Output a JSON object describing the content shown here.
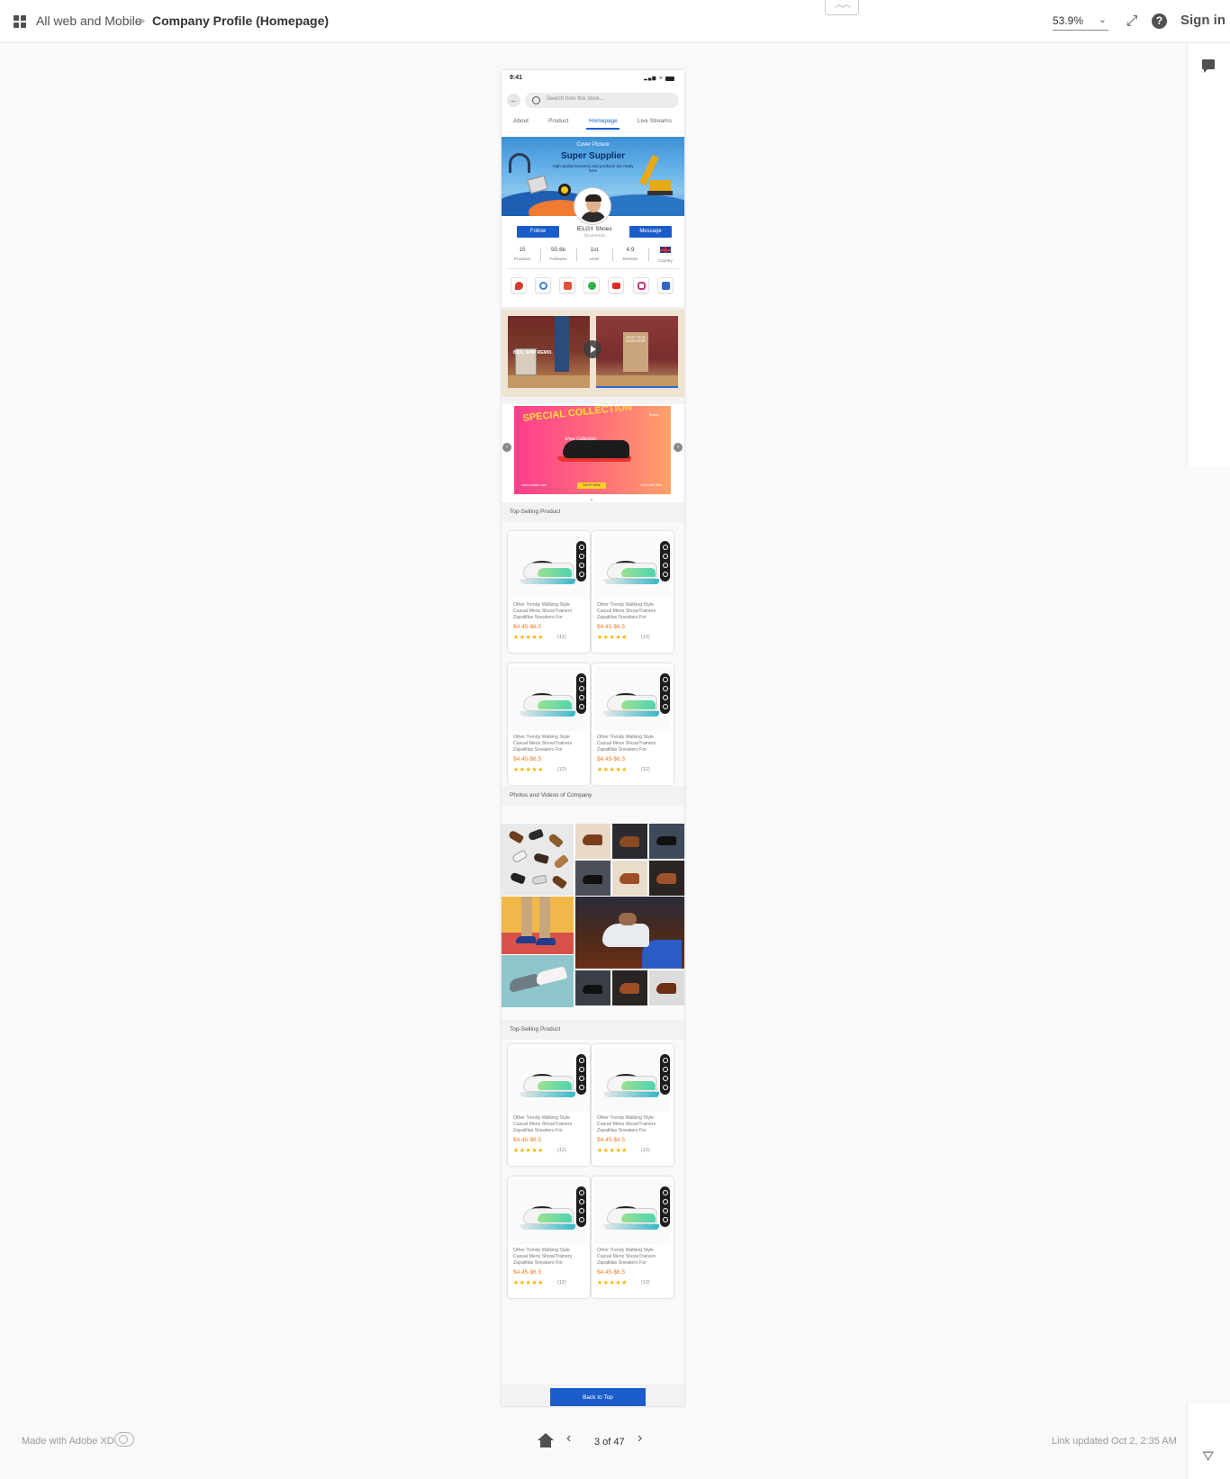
{
  "topbar": {
    "breadcrumb_root": "All web and Mobile",
    "breadcrumb_separator": ">",
    "breadcrumb_current": "Company Profile (Homepage)",
    "zoom": "53.9%",
    "sign_in": "Sign in"
  },
  "footer": {
    "made_with": "Made with Adobe XD",
    "page_indicator": "3 of 47",
    "link_updated": "Link updated Oct 2, 2:35 AM"
  },
  "phone": {
    "status_time": "9:41",
    "search_placeholder": "Search from this store...",
    "tabs": [
      "About",
      "Product",
      "Homepage",
      "Live Streams"
    ],
    "active_tab": "Homepage",
    "cover": {
      "label": "Cover Picture",
      "title": "Super Supplier",
      "subtitle": "High quality business and products are ready here"
    },
    "profile": {
      "follow_label": "Follow",
      "message_label": "Message",
      "name": "IELGY Shoes",
      "handle": "@name123"
    },
    "stats": [
      {
        "value": "15",
        "label": "Products"
      },
      {
        "value": "50.6k",
        "label": "Followers"
      },
      {
        "value": "1st",
        "label": "Level"
      },
      {
        "value": "4.9",
        "label": "Reviews"
      },
      {
        "value": "",
        "label": "Country"
      }
    ],
    "social_icons": [
      {
        "name": "location-icon",
        "color": "#d23b2e"
      },
      {
        "name": "website-icon",
        "color": "#3b7fd0"
      },
      {
        "name": "shop-icon",
        "color": "#e0553a"
      },
      {
        "name": "whatsapp-icon",
        "color": "#35b04b"
      },
      {
        "name": "youtube-icon",
        "color": "#e02a2a"
      },
      {
        "name": "instagram-icon",
        "color": "#c23787"
      },
      {
        "name": "facebook-icon",
        "color": "#3266c8"
      }
    ],
    "video": {
      "left_text": "BOX, SHIP REMIX.",
      "right_text": "SHOP YOUR SHOES HERE"
    },
    "banner": {
      "title": "SPECIAL COLLECTION",
      "script": "Shoe Collection",
      "button": "SHOP NOW",
      "footer_left": "www.website.com",
      "footer_right": "+123-456-7890",
      "logo": "Brand"
    },
    "section_top_selling": "Top-Selling Product",
    "section_photos": "Photos and Videos of Company",
    "product": {
      "title_line1": "Other Trendy Walking Style",
      "title_line2": "Casual Mens ShoseTrainers",
      "title_line3": "Zapatillas Sneakers For",
      "price": "$4.45-$6.5",
      "stars": "★★★★★",
      "review_count": "(12)"
    },
    "back_to_top": "Back to Top"
  },
  "colors": {
    "accent": "#1b5ccc",
    "price": "#f07a21",
    "star": "#f6b400"
  }
}
